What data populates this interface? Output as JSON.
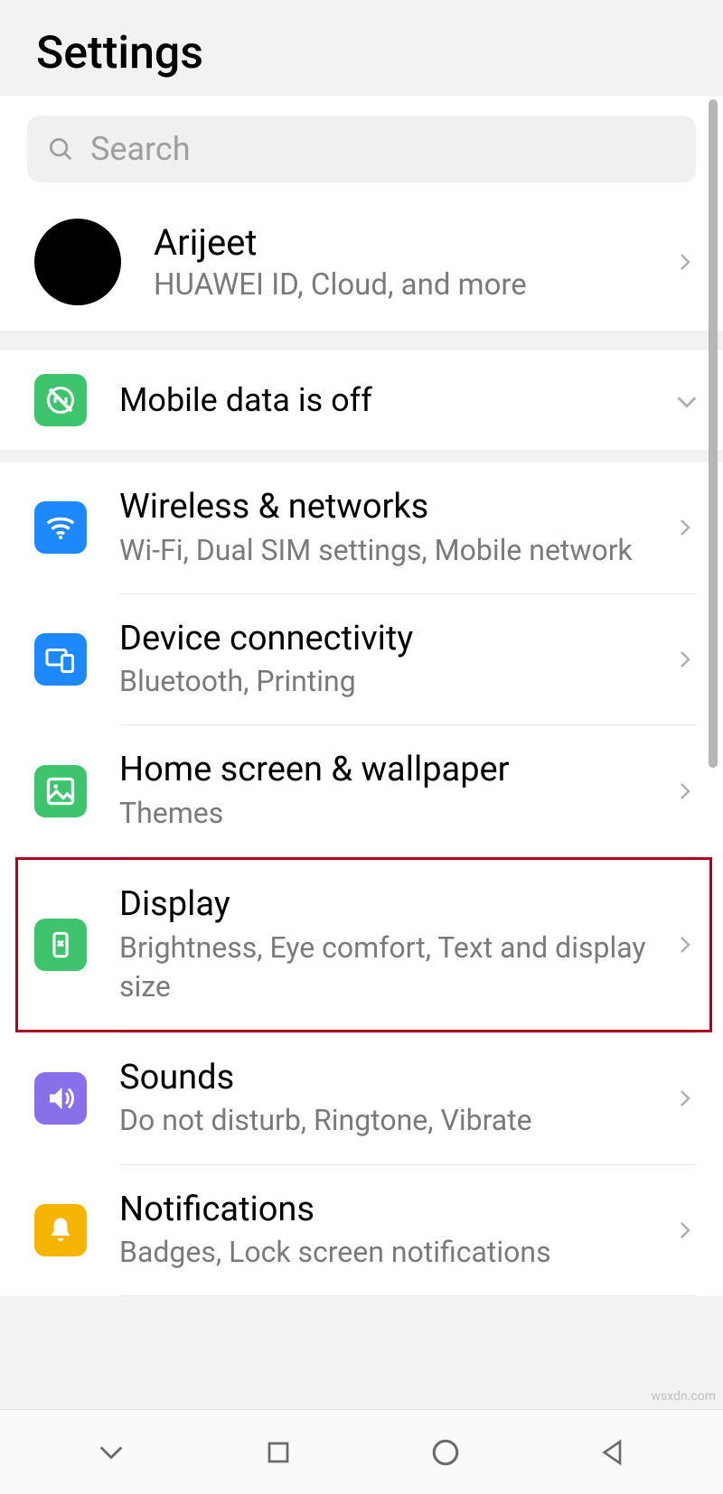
{
  "header": {
    "title": "Settings"
  },
  "search": {
    "placeholder": "Search"
  },
  "account": {
    "name": "Arijeet",
    "subtitle": "HUAWEI ID, Cloud, and more"
  },
  "mobile_data": {
    "label": "Mobile data is off"
  },
  "items": {
    "wireless": {
      "title": "Wireless & networks",
      "subtitle": "Wi-Fi, Dual SIM settings, Mobile network"
    },
    "device_connectivity": {
      "title": "Device connectivity",
      "subtitle": "Bluetooth, Printing"
    },
    "home_screen": {
      "title": "Home screen & wallpaper",
      "subtitle": "Themes"
    },
    "display": {
      "title": "Display",
      "subtitle": "Brightness, Eye comfort, Text and display size"
    },
    "sounds": {
      "title": "Sounds",
      "subtitle": "Do not disturb, Ringtone, Vibrate"
    },
    "notifications": {
      "title": "Notifications",
      "subtitle": "Badges, Lock screen notifications"
    }
  },
  "watermark": "wsxdn.com"
}
